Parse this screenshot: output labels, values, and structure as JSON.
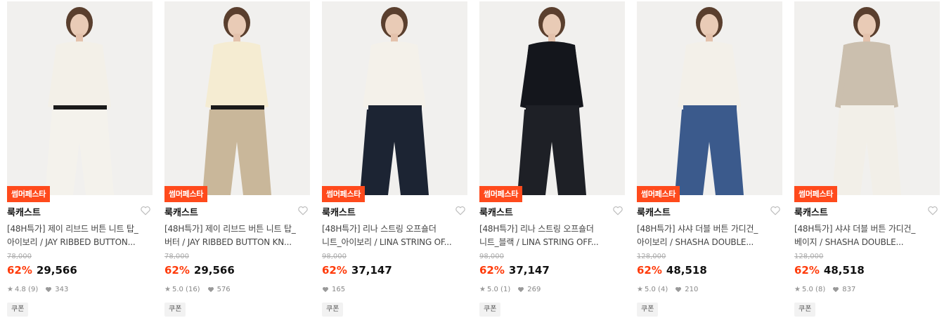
{
  "products": [
    {
      "badge": "썸머페스타",
      "brand": "룩캐스트",
      "title_line1": "[48H특가] 제이 리브드 버튼 니트 탑_",
      "title_line2": "아이보리 / JAY RIBBED BUTTON...",
      "original_price": "78,000",
      "discount": "62%",
      "price": "29,566",
      "rating": "4.8 (9)",
      "likes": "343",
      "coupon": "쿠폰",
      "colors": {
        "top": "#f3f0e8",
        "bottom": "#f4f2ec",
        "belt": "#1a1a1a"
      }
    },
    {
      "badge": "썸머페스타",
      "brand": "룩캐스트",
      "title_line1": "[48H특가] 제이 리브드 버튼 니트 탑_",
      "title_line2": "버터 / JAY RIBBED BUTTON KN...",
      "original_price": "78,000",
      "discount": "62%",
      "price": "29,566",
      "rating": "5.0 (16)",
      "likes": "576",
      "coupon": "쿠폰",
      "colors": {
        "top": "#f5ecd2",
        "bottom": "#c9b79a",
        "belt": "#1a1a1a"
      }
    },
    {
      "badge": "썸머페스타",
      "brand": "룩캐스트",
      "title_line1": "[48H특가] 리나 스트링 오프숄더",
      "title_line2": "니트_아이보리 / LINA STRING OF...",
      "original_price": "98,000",
      "discount": "62%",
      "price": "37,147",
      "rating": "",
      "likes": "165",
      "coupon": "쿠폰",
      "colors": {
        "top": "#f4f1ea",
        "bottom": "#1c2433",
        "belt": "#1c2433"
      }
    },
    {
      "badge": "썸머페스타",
      "brand": "룩캐스트",
      "title_line1": "[48H특가] 리나 스트링 오프숄더",
      "title_line2": "니트_블랙 / LINA STRING OFF...",
      "original_price": "98,000",
      "discount": "62%",
      "price": "37,147",
      "rating": "5.0 (1)",
      "likes": "269",
      "coupon": "쿠폰",
      "colors": {
        "top": "#14161c",
        "bottom": "#1e2026",
        "belt": "#1e2026"
      }
    },
    {
      "badge": "썸머페스타",
      "brand": "룩캐스트",
      "title_line1": "[48H특가] 샤샤 더블 버튼 가디건_",
      "title_line2": "아이보리 / SHASHA DOUBLE...",
      "original_price": "128,000",
      "discount": "62%",
      "price": "48,518",
      "rating": "5.0 (4)",
      "likes": "210",
      "coupon": "쿠폰",
      "colors": {
        "top": "#f3f0e9",
        "bottom": "#3b5a8c",
        "belt": "#3b5a8c"
      }
    },
    {
      "badge": "썸머페스타",
      "brand": "룩캐스트",
      "title_line1": "[48H특가] 샤샤 더블 버튼 가디건_",
      "title_line2": "베이지 / SHASHA DOUBLE...",
      "original_price": "128,000",
      "discount": "62%",
      "price": "48,518",
      "rating": "5.0 (8)",
      "likes": "837",
      "coupon": "쿠폰",
      "colors": {
        "top": "#cbbfae",
        "bottom": "#f2efe8",
        "belt": "#f2efe8"
      }
    }
  ]
}
